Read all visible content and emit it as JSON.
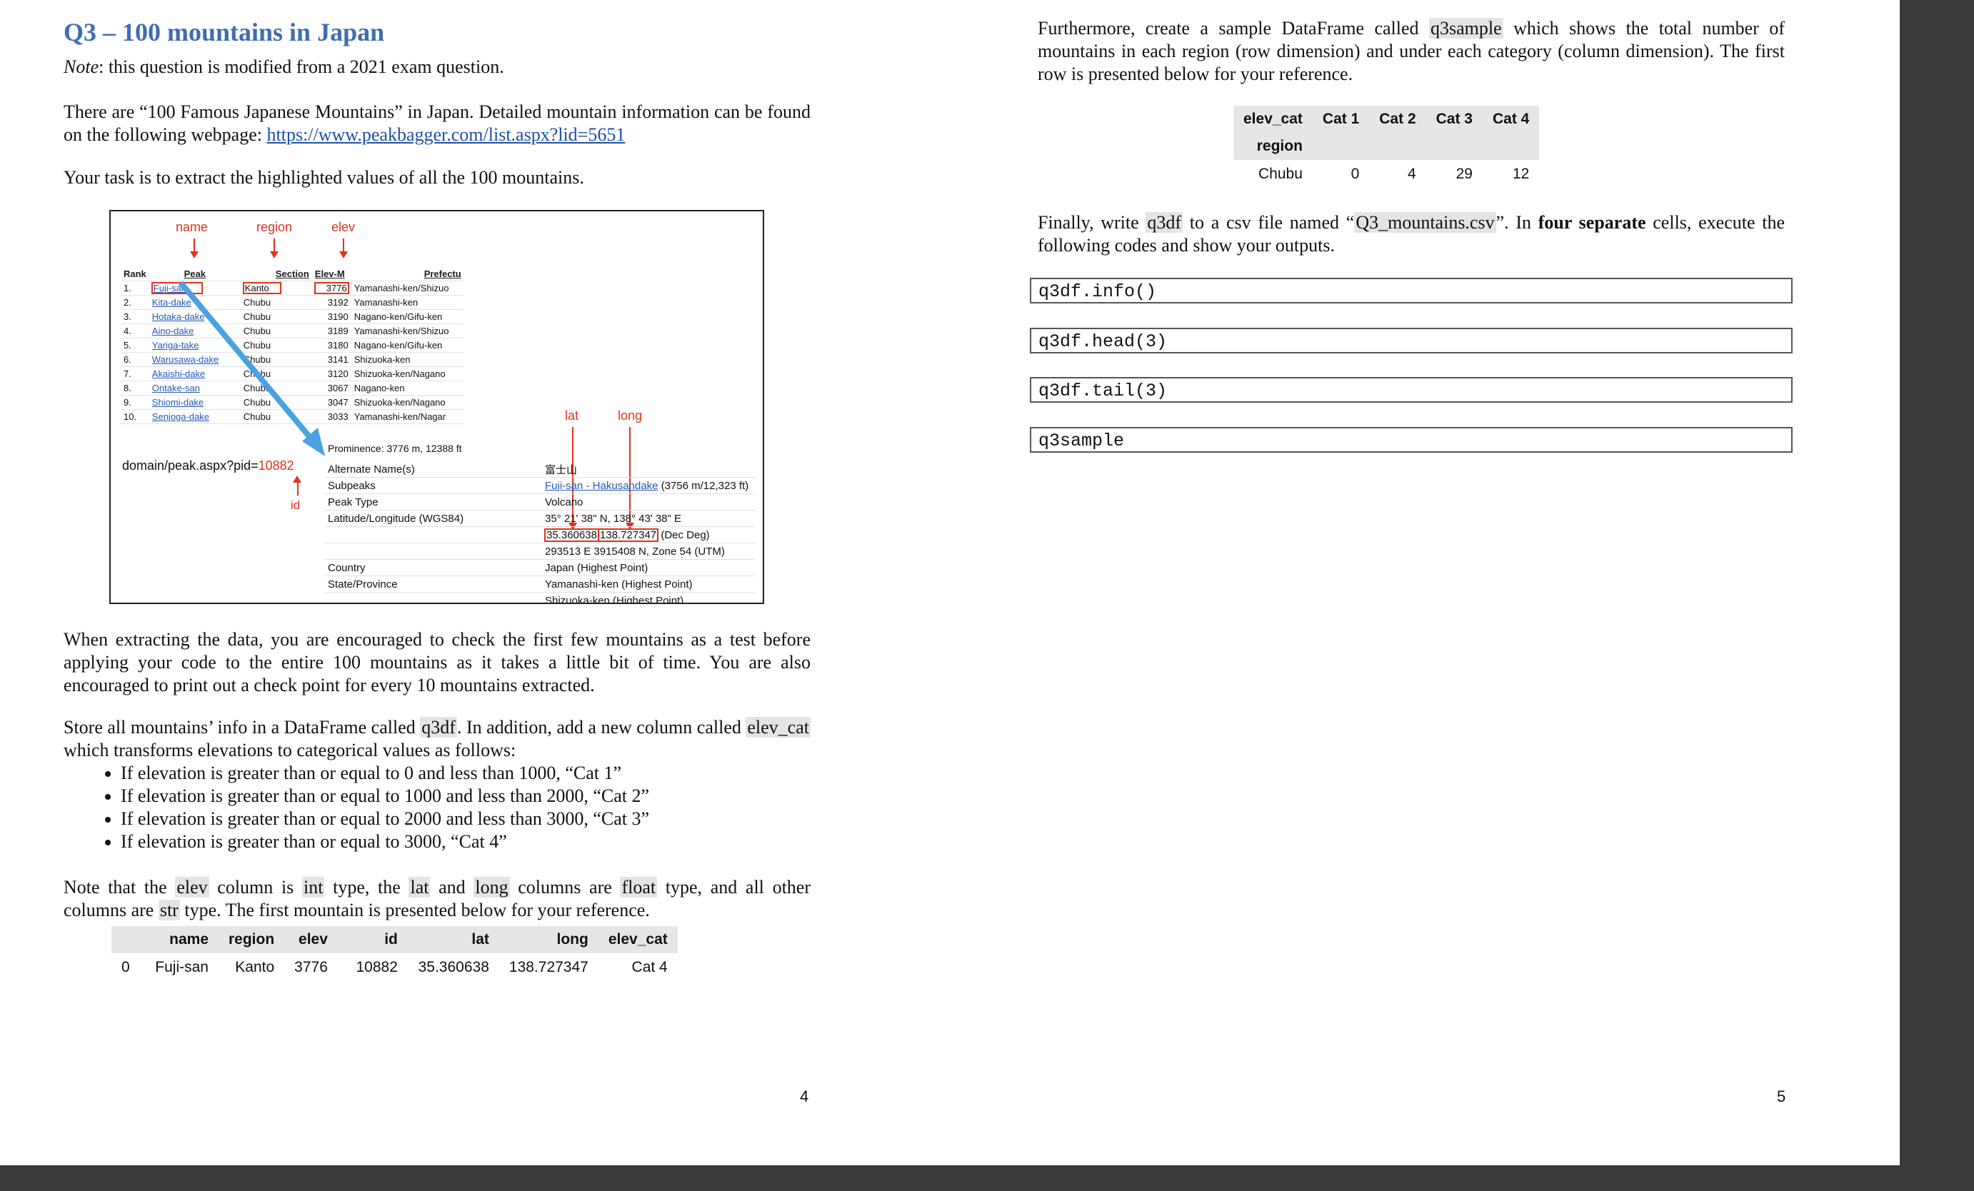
{
  "left_page": {
    "title": "Q3 – 100 mountains in Japan",
    "note_label": "Note",
    "note_text": ": this question is modified from a 2021 exam question.",
    "intro_1": "There are “100 Famous Japanese Mountains” in Japan. Detailed mountain information can be found on the following webpage:",
    "intro_link": "https://www.peakbagger.com/list.aspx?lid=5651",
    "task": "Your task is to extract the highlighted values of all the 100 mountains.",
    "para_extract": "When extracting the data, you are encouraged to check the first few mountains as a test before applying your code to the entire 100 mountains as it takes a little bit of time. You are also encouraged to print out a check point for every 10 mountains extracted.",
    "store_1": "Store all mountains’ info in a DataFrame called ",
    "store_var": "q3df",
    "store_2": ". In addition, add a new column called ",
    "store_col": "elev_cat",
    "store_3": " which transforms elevations to categorical values as follows:",
    "bullets": [
      "If elevation is greater than or equal to 0 and less than 1000, “Cat 1”",
      "If elevation is greater than or equal to 1000 and less than 2000, “Cat 2”",
      "If elevation is greater than or equal to 2000 and less than 3000, “Cat 3”",
      "If elevation is greater than or equal to 3000, “Cat 4”"
    ],
    "types_1": "Note that the ",
    "types_elev": "elev",
    "types_2": " column is ",
    "types_int": "int",
    "types_3": " type, the ",
    "types_lat": "lat",
    "types_4": " and ",
    "types_long": "long",
    "types_5": " columns are ",
    "types_float": "float",
    "types_6": " type, and all other columns are ",
    "types_str": "str",
    "types_7": " type. The first mountain is presented below for your reference.",
    "df_headers": [
      "",
      "name",
      "region",
      "elev",
      "id",
      "lat",
      "long",
      "elev_cat"
    ],
    "df_row": [
      "0",
      "Fuji-san",
      "Kanto",
      "3776",
      "10882",
      "35.360638",
      "138.727347",
      "Cat 4"
    ],
    "page_number": "4"
  },
  "figure": {
    "label_name": "name",
    "label_region": "region",
    "label_elev": "elev",
    "label_lat": "lat",
    "label_long": "long",
    "label_id": "id",
    "domain_prefix": "domain/peak.aspx?pid=",
    "domain_id": "10882",
    "table_headers": [
      "Rank",
      "Peak",
      "Section",
      "Elev-M",
      "Prefectu"
    ],
    "table_rows": [
      [
        "1.",
        "Fuji-san",
        "Kanto",
        "3776",
        "Yamanashi-ken/Shizuo"
      ],
      [
        "2.",
        "Kita-dake",
        "Chubu",
        "3192",
        "Yamanashi-ken"
      ],
      [
        "3.",
        "Hotaka-dake",
        "Chubu",
        "3190",
        "Nagano-ken/Gifu-ken"
      ],
      [
        "4.",
        "Aino-dake",
        "Chubu",
        "3189",
        "Yamanashi-ken/Shizuo"
      ],
      [
        "5.",
        "Yariga-take",
        "Chubu",
        "3180",
        "Nagano-ken/Gifu-ken"
      ],
      [
        "6.",
        "Warusawa-dake",
        "Chubu",
        "3141",
        "Shizuoka-ken"
      ],
      [
        "7.",
        "Akaishi-dake",
        "Chubu",
        "3120",
        "Shizuoka-ken/Nagano"
      ],
      [
        "8.",
        "Ontake-san",
        "Chubu",
        "3067",
        "Nagano-ken"
      ],
      [
        "9.",
        "Shiomi-dake",
        "Chubu",
        "3047",
        "Shizuoka-ken/Nagano"
      ],
      [
        "10.",
        "Senjoga-dake",
        "Chubu",
        "3033",
        "Yamanashi-ken/Nagar"
      ]
    ],
    "prominence": "Prominence: 3776 m, 12388 ft",
    "detail_labels": [
      "Alternate Name(s)",
      "Subpeaks",
      "Peak Type",
      "Latitude/Longitude (WGS84)",
      "",
      "",
      "Country",
      "State/Province",
      ""
    ],
    "detail_alt_name": "富士山",
    "detail_subpeak_link": "Fuji-san - Hakusandake",
    "detail_subpeak_rest": " (3756 m/12,323 ft)",
    "detail_peak_type": "Volcano",
    "detail_dms": "35° 21' 38\" N, 138° 43' 38\" E",
    "detail_lat": "35.360638",
    "detail_long": "138.727347",
    "detail_decdeg": " (Dec Deg)",
    "detail_utm": "293513 E 3915408 N, Zone 54 (UTM)",
    "detail_country": "Japan (Highest Point)",
    "detail_state_1": "Yamanashi-ken (Highest Point)",
    "detail_state_2": "Shizuoka-ken (Highest Point)"
  },
  "right_page": {
    "para_1a": "Furthermore, create a sample DataFrame called ",
    "para_1var": "q3sample",
    "para_1b": " which shows the total number of mountains in each region (row dimension) and under each category (column dimension). The first row is presented below for your reference.",
    "sample_header": [
      "elev_cat",
      "Cat 1",
      "Cat 2",
      "Cat 3",
      "Cat 4"
    ],
    "sample_index_name": "region",
    "sample_row": [
      "Chubu",
      "0",
      "4",
      "29",
      "12"
    ],
    "para_2a": "Finally, write ",
    "para_2var": "q3df",
    "para_2b": " to a csv file named “",
    "para_2file": "Q3_mountains.csv",
    "para_2c": "”. In ",
    "para_2bold": "four separate",
    "para_2d": " cells, execute the following codes and show your outputs.",
    "code_cells": [
      "q3df.info()",
      "q3df.head(3)",
      "q3df.tail(3)",
      "q3sample"
    ],
    "page_number": "5"
  }
}
